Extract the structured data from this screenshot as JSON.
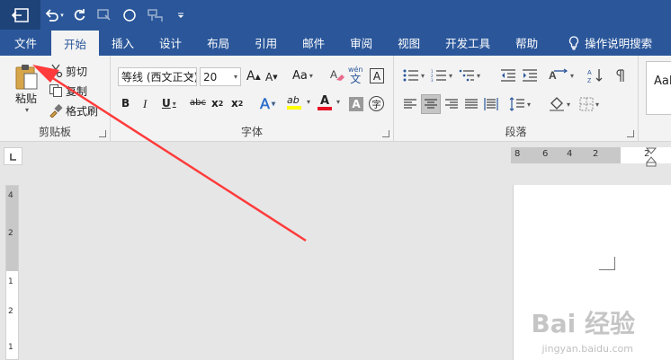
{
  "title_bar": {
    "icons": [
      "back-icon",
      "undo-icon",
      "redo-icon",
      "touch-mode-icon",
      "circle-shape-icon",
      "format-painter-icon",
      "customize-qat-icon"
    ]
  },
  "tabs": [
    {
      "label": "文件",
      "active": false
    },
    {
      "label": "开始",
      "active": true
    },
    {
      "label": "插入",
      "active": false
    },
    {
      "label": "设计",
      "active": false
    },
    {
      "label": "布局",
      "active": false
    },
    {
      "label": "引用",
      "active": false
    },
    {
      "label": "邮件",
      "active": false
    },
    {
      "label": "审阅",
      "active": false
    },
    {
      "label": "视图",
      "active": false
    },
    {
      "label": "开发工具",
      "active": false
    },
    {
      "label": "帮助",
      "active": false
    }
  ],
  "tell_me": "操作说明搜索",
  "clipboard": {
    "group_label": "剪贴板",
    "paste": "粘贴",
    "cut": "剪切",
    "copy": "复制",
    "format_painter": "格式刷"
  },
  "font": {
    "group_label": "字体",
    "font_name": "等线 (西文正文)",
    "font_size": "20",
    "grow": "A",
    "shrink": "A",
    "change_case": "Aa",
    "phonetic": "wén",
    "phonetic_char": "文",
    "border_char": "A",
    "bold": "B",
    "italic": "I",
    "underline": "U",
    "strike": "abc",
    "subscript": "x",
    "subscript_mark": "2",
    "superscript": "x",
    "superscript_mark": "2",
    "text_effect": "A",
    "highlight": "ab",
    "font_color": "A",
    "char_shading": "A",
    "enclose": "字"
  },
  "paragraph": {
    "group_label": "段落"
  },
  "styles": {
    "preview": "AaI"
  },
  "ruler": {
    "h_ticks": [
      "8",
      "6",
      "4",
      "2",
      "2"
    ],
    "v_ticks": [
      "4",
      "2",
      "1",
      "2",
      "1"
    ]
  },
  "watermark": {
    "main": "Bai 经验",
    "sub": "jingyan.baidu.com"
  },
  "colors": {
    "accent": "#2b579a",
    "annotation_arrow": "#ff3b3b",
    "font_color_bar": "#e81123",
    "highlight_bar": "#ffff00"
  }
}
